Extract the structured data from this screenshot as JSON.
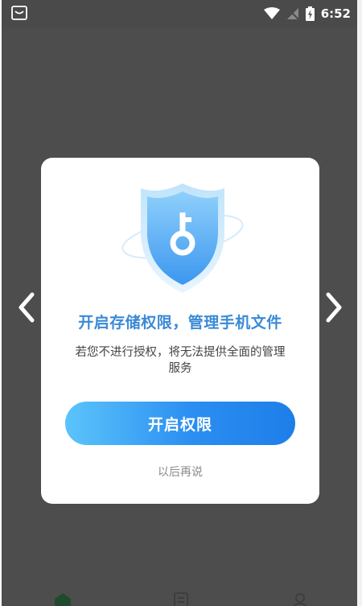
{
  "statusbar": {
    "time": "6:52",
    "icons": [
      "notification-icon",
      "wifi-icon",
      "signal-icon",
      "battery-icon"
    ]
  },
  "dialog": {
    "title": "开启存储权限，管理手机文件",
    "description": "若您不进行授权，将无法提供全面的管理服务",
    "primary_button": "开启权限",
    "secondary_link": "以后再说",
    "title_color": "#3a8ad6",
    "button_color": "#2b8ef1"
  },
  "navigation": {
    "prev_icon": "chevron-left-icon",
    "next_icon": "chevron-right-icon"
  },
  "tabbar": {
    "icons": [
      "home-icon",
      "files-icon",
      "profile-icon"
    ]
  }
}
